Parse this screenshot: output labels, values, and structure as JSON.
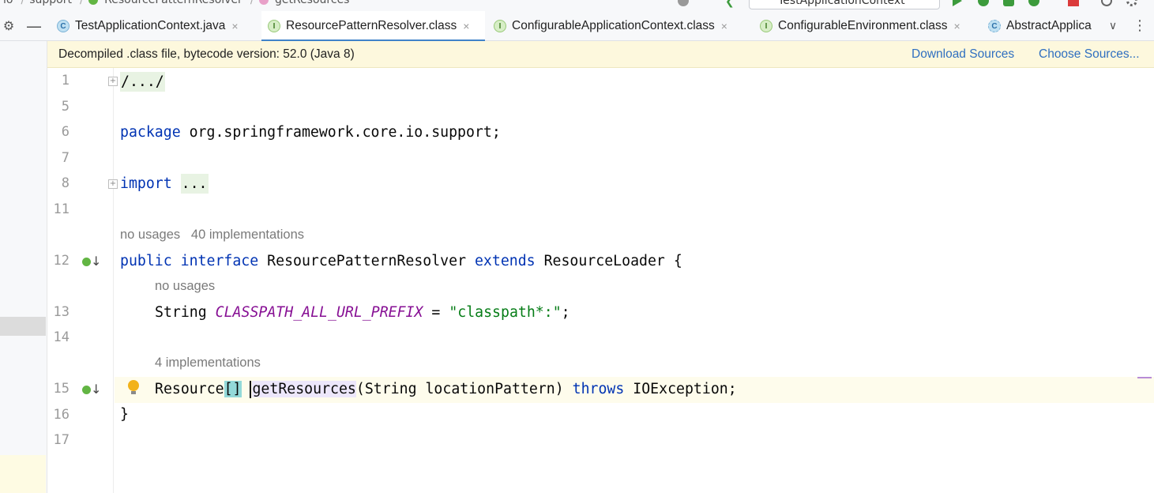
{
  "breadcrumb": {
    "items": [
      "io",
      "support",
      "ResourcePatternResolver",
      "getResources"
    ]
  },
  "run_config": {
    "label": "TestApplicationContext"
  },
  "tabs": [
    {
      "label": "TestApplicationContext.java",
      "icon": "class-icon",
      "active": false,
      "closable": true
    },
    {
      "label": "ResourcePatternResolver.class",
      "icon": "interface-icon",
      "active": true,
      "closable": true
    },
    {
      "label": "ConfigurableApplicationContext.class",
      "icon": "interface-icon",
      "active": false,
      "closable": true
    },
    {
      "label": "ConfigurableEnvironment.class",
      "icon": "interface-icon",
      "active": false,
      "closable": true
    },
    {
      "label": "AbstractApplica",
      "icon": "abstract-class-icon",
      "active": false,
      "closable": false
    }
  ],
  "tab_close_glyph": "×",
  "banner": {
    "message": "Decompiled .class file, bytecode version: 52.0 (Java 8)",
    "download_sources": "Download Sources",
    "choose_sources": "Choose Sources..."
  },
  "editor": {
    "line_numbers": [
      "1",
      "5",
      "6",
      "7",
      "8",
      "11",
      "12",
      "13",
      "14",
      "15",
      "16",
      "17"
    ],
    "folded_header": "/.../",
    "package_kw": "package",
    "package_name": " org.springframework.core.io.support;",
    "import_kw": "import",
    "import_fold": "...",
    "hint_interface_usages": "no usages",
    "hint_interface_impls": "40 implementations",
    "decl_public": "public",
    "decl_interface": "interface",
    "decl_name": " ResourcePatternResolver ",
    "decl_extends": "extends",
    "decl_parent": " ResourceLoader {",
    "hint_const_usages": "no usages",
    "const_type": "String ",
    "const_name": "CLASSPATH_ALL_URL_PREFIX",
    "const_eq": " = ",
    "const_value": "\"classpath*:\"",
    "const_semicolon": ";",
    "hint_method_impls": "4 implementations",
    "method_type": "Resource",
    "method_brackets": "[]",
    "method_name": "getResources",
    "method_params": "(String locationPattern) ",
    "method_throws": "throws",
    "method_exception": " IOException;",
    "closing_brace": "}"
  },
  "colors": {
    "keyword": "#0033b3",
    "constant": "#871094",
    "string": "#067d17",
    "banner_bg": "#fdf8dd",
    "link": "#2f6fc0",
    "active_tab_underline": "#4083c9"
  }
}
